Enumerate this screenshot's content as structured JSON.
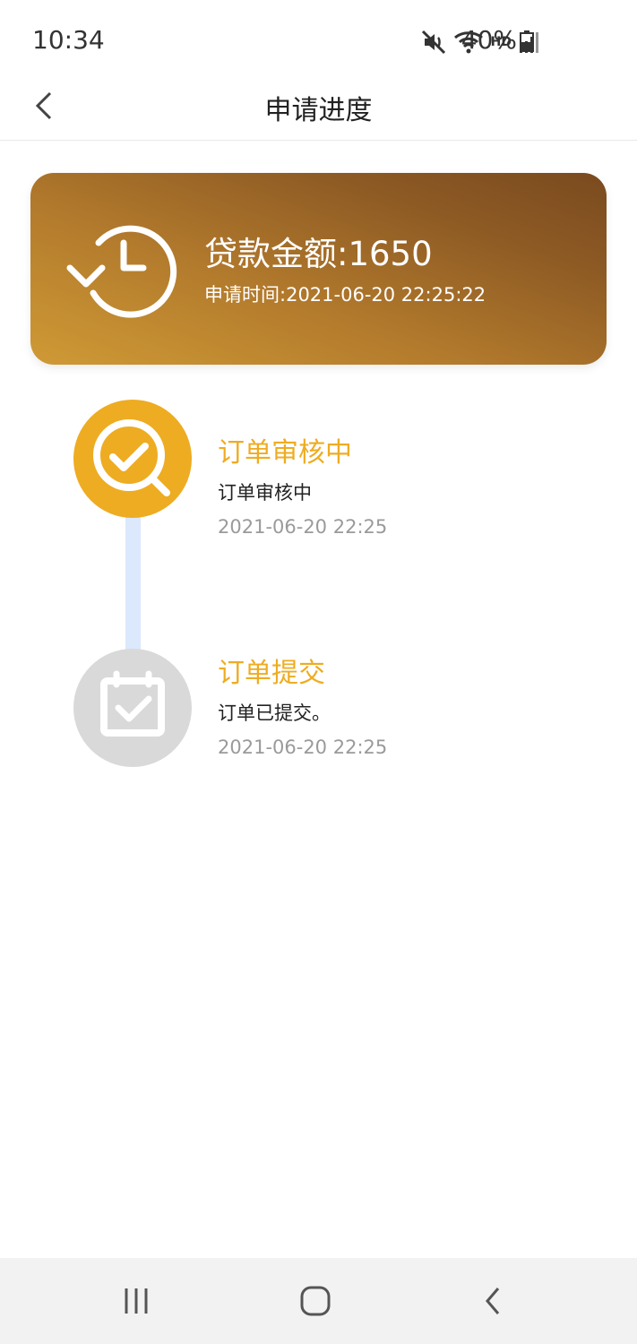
{
  "status_bar": {
    "time": "10:34",
    "network": "HD",
    "battery": "40%"
  },
  "header": {
    "title": "申请进度"
  },
  "summary": {
    "amount_label": "贷款金额:",
    "amount_value": "1650",
    "apply_time_label": "申请时间:",
    "apply_time_value": "2021-06-20 22:25:22"
  },
  "timeline": [
    {
      "title": "订单审核中",
      "description": "订单审核中",
      "time": "2021-06-20 22:25",
      "state": "active",
      "icon": "review-check-icon"
    },
    {
      "title": "订单提交",
      "description": "订单已提交。",
      "time": "2021-06-20 22:25",
      "state": "done",
      "icon": "calendar-check-icon"
    }
  ],
  "colors": {
    "accent": "#eeac22",
    "card_gradient_start": "#cf9a35",
    "card_gradient_end": "#7a4a1f",
    "timeline_line": "#dce8fb",
    "inactive_step": "#d9d9d9"
  }
}
